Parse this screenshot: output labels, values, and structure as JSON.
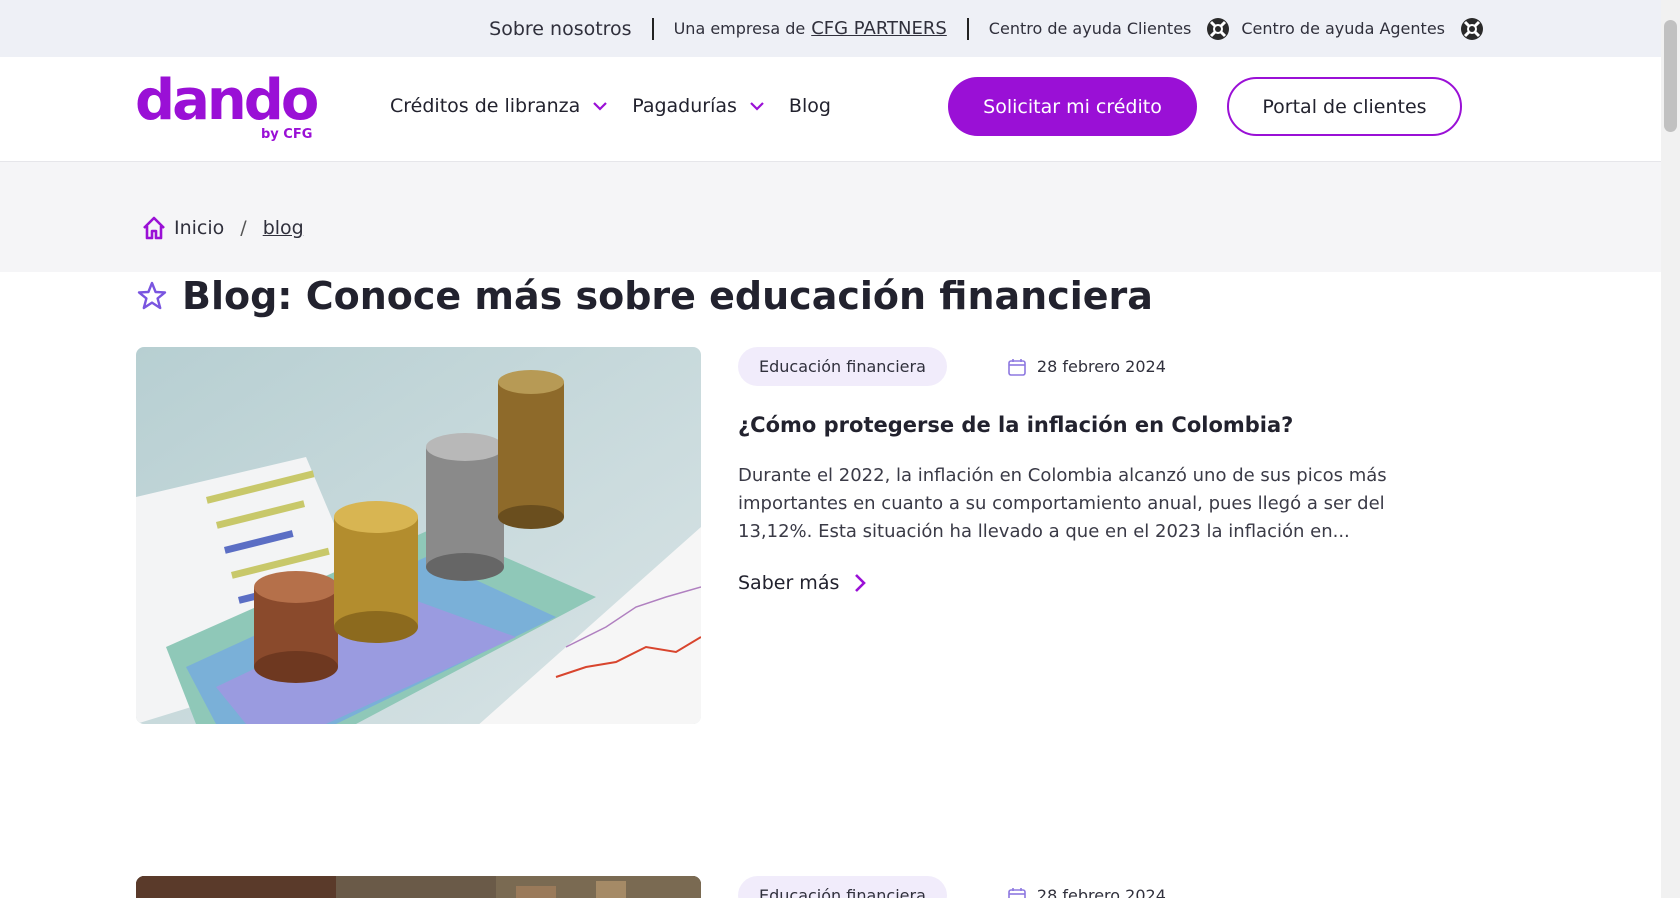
{
  "topbar": {
    "about": "Sobre nosotros",
    "company_prefix": "Una empresa de",
    "company_link": "CFG PARTNERS",
    "help_clients": "Centro de ayuda Clientes",
    "help_agents": "Centro de ayuda Agentes",
    "help_icon": "lifebuoy-icon"
  },
  "header": {
    "logo_word": "dando",
    "logo_sub": "by CFG",
    "nav": [
      {
        "label": "Créditos de libranza",
        "has_dropdown": true
      },
      {
        "label": "Pagadurías",
        "has_dropdown": true
      },
      {
        "label": "Blog",
        "has_dropdown": false
      }
    ],
    "cta_primary": "Solicitar mi crédito",
    "cta_secondary": "Portal de clientes"
  },
  "breadcrumb": {
    "home": "Inicio",
    "separator": "/",
    "current": "blog"
  },
  "page": {
    "title": "Blog: Conoce más sobre educación financiera"
  },
  "articles": [
    {
      "tag": "Educación financiera",
      "date": "28 febrero 2024",
      "title": "¿Cómo protegerse de la inflación en Colombia?",
      "excerpt": "Durante el 2022, la inflación en Colombia alcanzó uno de sus picos más importantes en cuanto a su comportamiento anual, pues llegó a ser del 13,12%. Esta situación ha llevado a que en el 2023 la inflación en...",
      "more": "Saber más"
    },
    {
      "tag": "Educación financiera",
      "date": "28 febrero 2024"
    }
  ],
  "colors": {
    "brand": "#9a10d6",
    "topbar_bg": "#eef0f6",
    "tag_bg": "#f1ecfb"
  }
}
